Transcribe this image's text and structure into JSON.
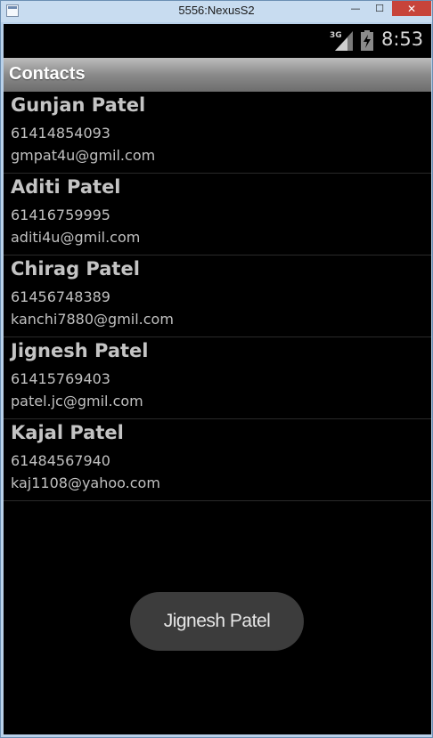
{
  "window": {
    "title": "5556:NexusS2",
    "minimize_glyph": "—",
    "maximize_glyph": "☐",
    "close_glyph": "✕"
  },
  "statusbar": {
    "network_label": "3G",
    "time": "8:53"
  },
  "actionbar": {
    "title": "Contacts"
  },
  "contacts": [
    {
      "name": "Gunjan Patel",
      "phone": "61414854093",
      "email": "gmpat4u@gmil.com"
    },
    {
      "name": "Aditi Patel",
      "phone": "61416759995",
      "email": "aditi4u@gmil.com"
    },
    {
      "name": "Chirag Patel",
      "phone": "61456748389",
      "email": "kanchi7880@gmil.com"
    },
    {
      "name": "Jignesh Patel",
      "phone": "61415769403",
      "email": "patel.jc@gmil.com"
    },
    {
      "name": "Kajal Patel",
      "phone": "61484567940",
      "email": "kaj1108@yahoo.com"
    }
  ],
  "toast": {
    "text": "Jignesh Patel"
  },
  "icons": {
    "app": "app-window-icon",
    "signal": "signal-strength-icon",
    "battery": "battery-charging-icon"
  }
}
